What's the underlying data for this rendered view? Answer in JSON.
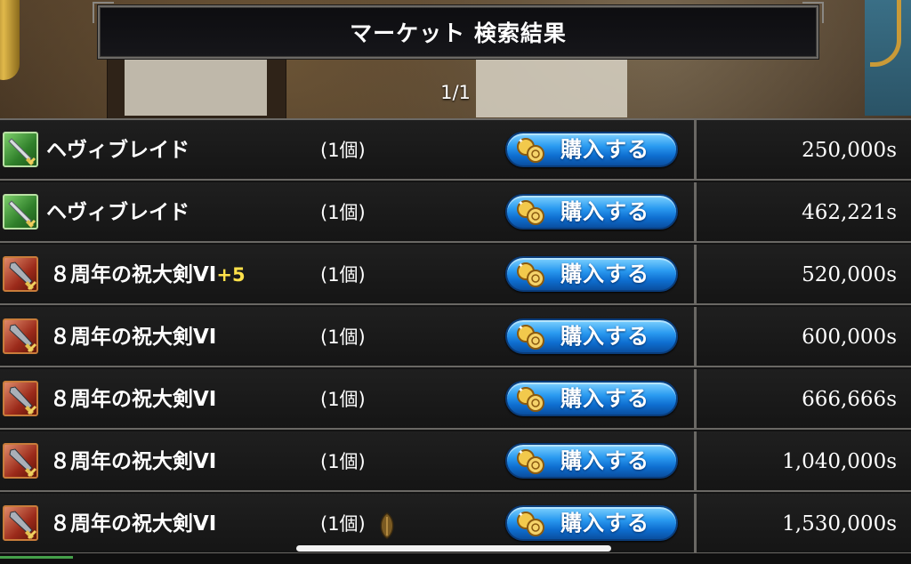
{
  "header": {
    "title": "マーケット 検索結果",
    "page_indicator": "1/1"
  },
  "listings": [
    {
      "icon": "greatsword-green-icon",
      "name": "ヘヴィブレイド",
      "enhance": "",
      "quantity": "(1個)",
      "buy_label": "購入する",
      "price": "250,000s",
      "extra_icon": ""
    },
    {
      "icon": "greatsword-green-icon",
      "name": "ヘヴィブレイド",
      "enhance": "",
      "quantity": "(1個)",
      "buy_label": "購入する",
      "price": "462,221s",
      "extra_icon": ""
    },
    {
      "icon": "greatsword-red-icon",
      "name": "８周年の祝大剣VI",
      "enhance": "+5",
      "quantity": "(1個)",
      "buy_label": "購入する",
      "price": "520,000s",
      "extra_icon": ""
    },
    {
      "icon": "greatsword-red-icon",
      "name": "８周年の祝大剣VI",
      "enhance": "",
      "quantity": "(1個)",
      "buy_label": "購入する",
      "price": "600,000s",
      "extra_icon": ""
    },
    {
      "icon": "greatsword-red-icon",
      "name": "８周年の祝大剣VI",
      "enhance": "",
      "quantity": "(1個)",
      "buy_label": "購入する",
      "price": "666,666s",
      "extra_icon": ""
    },
    {
      "icon": "greatsword-red-icon",
      "name": "８周年の祝大剣VI",
      "enhance": "",
      "quantity": "(1個)",
      "buy_label": "購入する",
      "price": "1,040,000s",
      "extra_icon": ""
    },
    {
      "icon": "greatsword-red-icon",
      "name": "８周年の祝大剣VI",
      "enhance": "",
      "quantity": "(1個)",
      "buy_label": "購入する",
      "price": "1,530,000s",
      "extra_icon": "seed-icon"
    }
  ],
  "colors": {
    "buy_button": "#1e88e5",
    "enhance_text": "#ffe14a",
    "row_border": "#6a6864"
  }
}
